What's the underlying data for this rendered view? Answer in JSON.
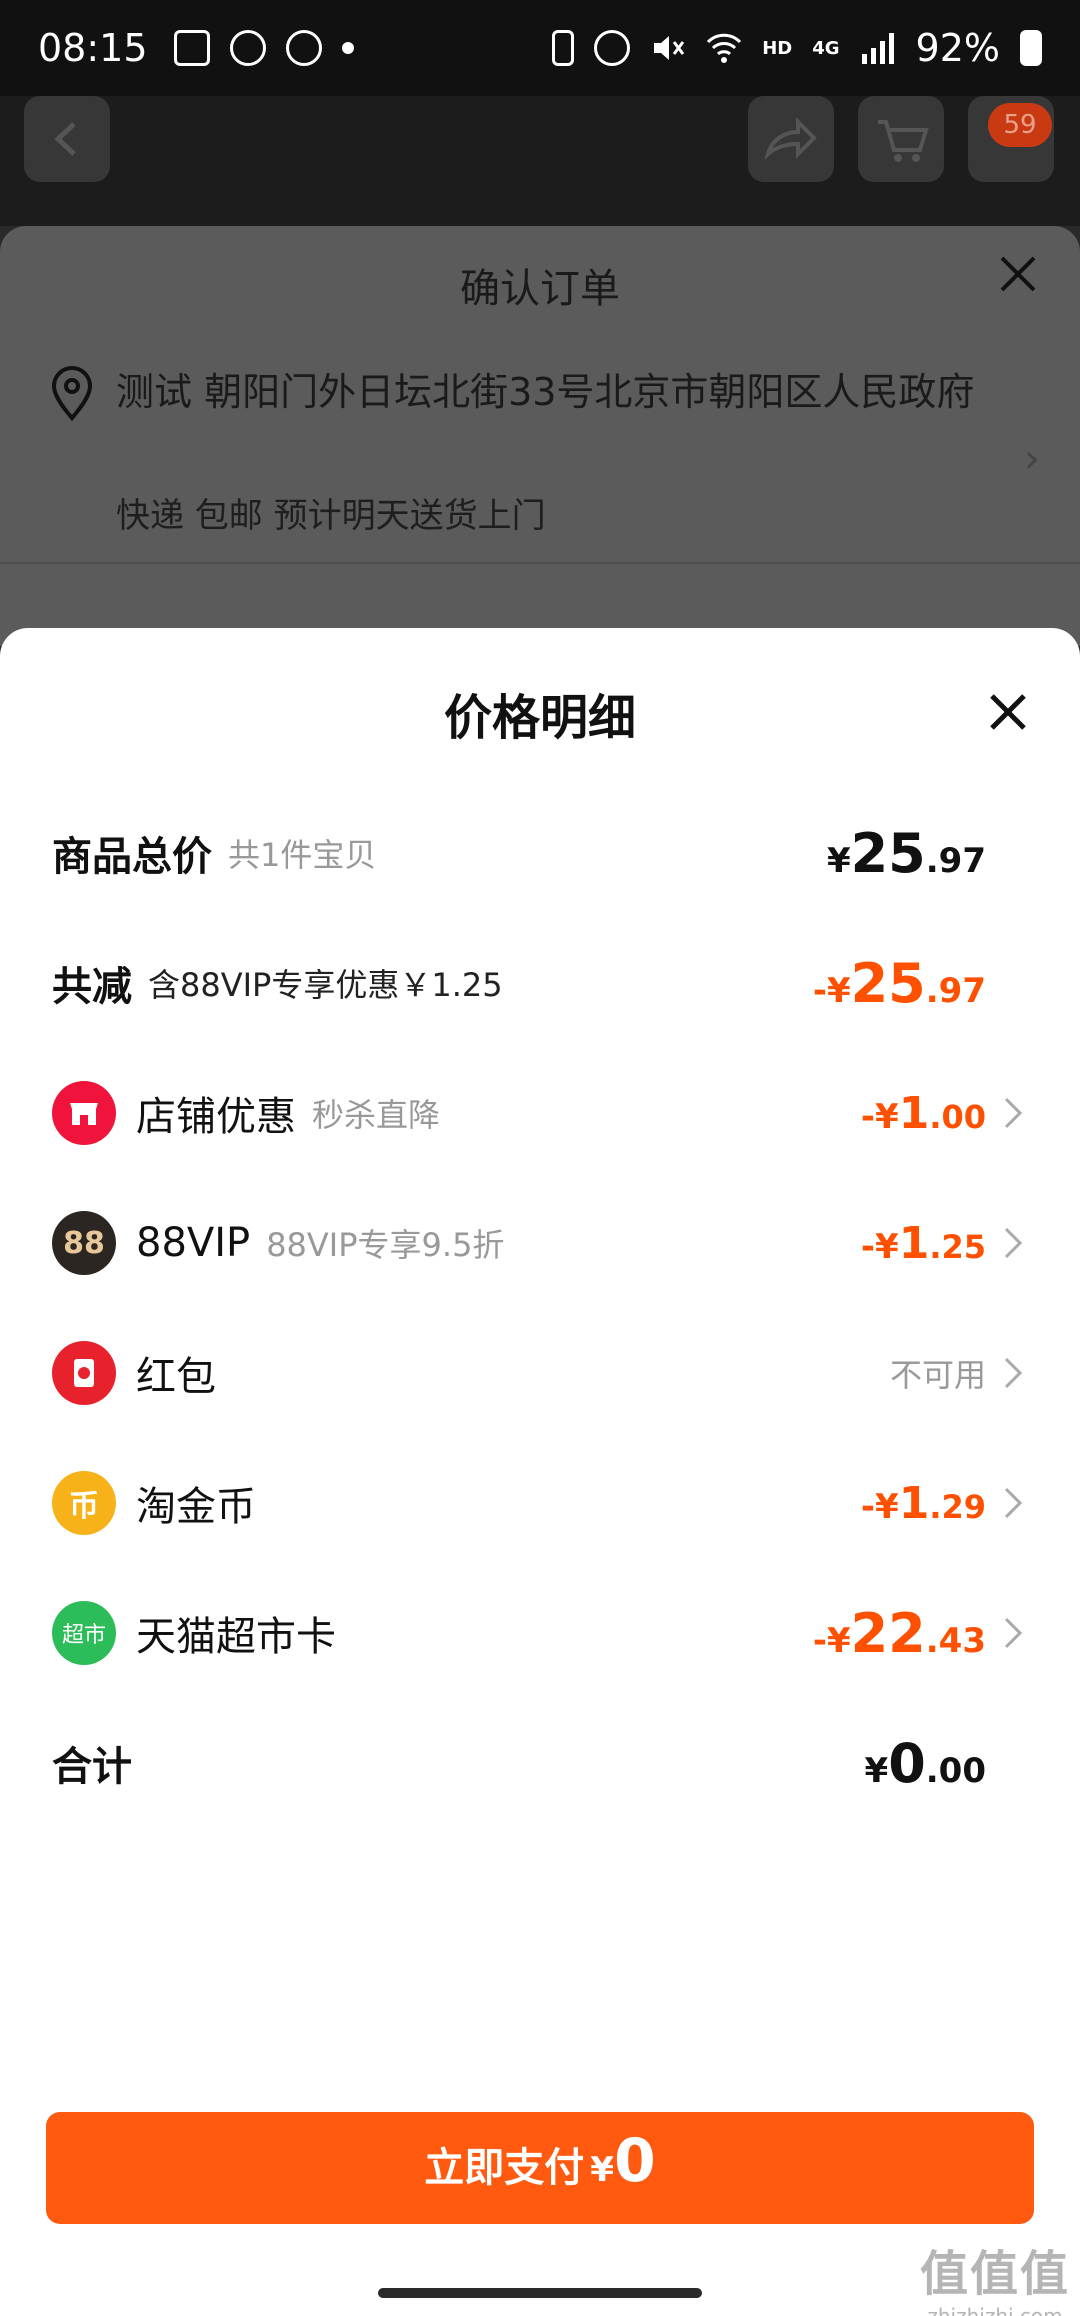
{
  "status_bar": {
    "time": "08:15",
    "network": "HD",
    "signal_label": "4G",
    "battery": "92%"
  },
  "background_page": {
    "cart_badge": "59"
  },
  "confirm_order": {
    "title": "确认订单",
    "address": "测试 朝阳门外日坛北街33号北京市朝阳区人民政府",
    "shipping": "快递 包邮 预计明天送货上门"
  },
  "price_detail": {
    "title": "价格明细",
    "subtotal": {
      "label": "商品总价",
      "sub": "共1件宝贝",
      "yen": "¥",
      "int": "25",
      "dec": ".97"
    },
    "total_discount": {
      "label": "共减",
      "sub": "含88VIP专享优惠￥1.25",
      "yen": "-¥",
      "int": "25",
      "dec": ".97"
    },
    "items": [
      {
        "icon": "store-coupon-icon",
        "icon_color": "#f0143c",
        "label": "店铺优惠",
        "sub": "秒杀直降",
        "yen": "-¥",
        "int": "1",
        "dec": ".00"
      },
      {
        "icon": "88vip-icon",
        "icon_color": "#2b2621",
        "icon_text": "88",
        "label": "88VIP",
        "sub": "88VIP专享9.5折",
        "yen": "-¥",
        "int": "1",
        "dec": ".25"
      },
      {
        "icon": "red-packet-icon",
        "icon_color": "#e8222c",
        "label": "红包",
        "unavailable": "不可用"
      },
      {
        "icon": "taojin-coin-icon",
        "icon_color": "#f7b21a",
        "icon_text": "币",
        "label": "淘金币",
        "yen": "-¥",
        "int": "1",
        "dec": ".29"
      },
      {
        "icon": "tmall-supermarket-card-icon",
        "icon_color": "#2dbc5a",
        "icon_text": "超市",
        "label": "天猫超市卡",
        "yen": "-¥",
        "int": "22",
        "dec": ".43"
      }
    ],
    "total": {
      "label": "合计",
      "yen": "¥",
      "int": "0",
      "dec": ".00"
    }
  },
  "pay_button": {
    "label": "立即支付",
    "yen": "¥",
    "amount": "0"
  },
  "watermark": {
    "text": "值值值",
    "site": "zhizhizhi.com"
  },
  "colors": {
    "accent": "#ff5000",
    "pay_button": "#ff5a10"
  }
}
